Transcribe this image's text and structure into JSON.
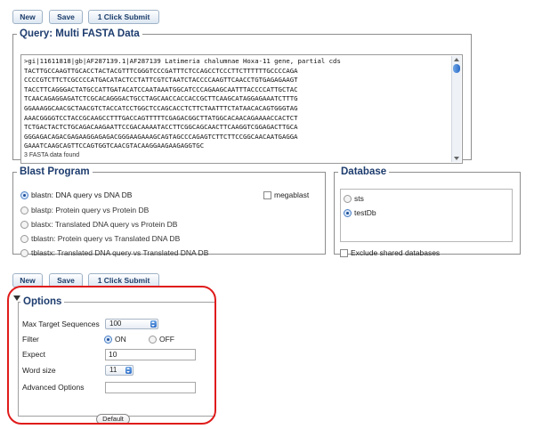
{
  "toolbar_top": {
    "new_label": "New",
    "save_label": "Save",
    "submit_label": "1 Click Submit"
  },
  "toolbar_bottom": {
    "new_label": "New",
    "save_label": "Save",
    "submit_label": "1 Click Submit"
  },
  "query": {
    "legend": "Query: Multi FASTA Data",
    "fasta_lines": [
      ">gi|11611818|gb|AF287139.1|AF287139 Latimeria chalumnae Hoxa-11 gene, partial cds",
      "TACTTGCCAAGTTGCACCTACTACGTTTCGGGTCCCGATTTCTCCAGCCTCCCTTCTTTTTTGCCCCAGA",
      "CCCCGTCTTCTCGCCCCATGACATACTCCTATTCGTCTAATCTACCCCAAGTTCAACCTGTGAGAGAAGT",
      "TACCTTCAGGGACTATGCCATTGATACATCCAATAAATGGCATCCCAGAAGCAATTTACCCCATTGCTAC",
      "TCAACAGAGGAGATCTCGCACAGGGACTGCCTAGCAACCACCACCGCTTCAAGCATAGGAGAAATCTTTG",
      "GGAAAGGCAACGCTAACGTCTACCATCCTGGCTCCAGCACCTCTTCTAATTTCTATAACACAGTGGGTAG",
      "AAACGGGGTCCTACCGCAAGCCTTTGACCAGTTTTTCGAGACGGCTTATGGCACAACAGAAAACCACTCT",
      "TCTGACTACTCTGCAGACAAGAATTCCGACAAAATACCTTCGGCAGCAACTTCAAGGTCGGAGACTTGCA",
      "GGGAGACAGACGAGAAGGAGAGACGGGAAGAAAGCAGTAGCCCAGAGTCTTCTTCCGGCAACAATGAGGA",
      "GAAATCAAGCAGTTCCAGTGGTCAACGTACAAGGAAGAAGAGGTGC"
    ],
    "count_text": "3 FASTA data found"
  },
  "blast_program": {
    "legend": "Blast Program",
    "options": [
      {
        "label": "blastn: DNA query vs DNA DB",
        "selected": true
      },
      {
        "label": "blastp: Protein query vs Protein DB",
        "selected": false
      },
      {
        "label": "blastx: Translated DNA query vs Protein DB",
        "selected": false
      },
      {
        "label": "tblastn: Protein query vs Translated DNA DB",
        "selected": false
      },
      {
        "label": "tblastx: Translated DNA query vs Translated DNA DB",
        "selected": false
      }
    ],
    "megablast_label": "megablast"
  },
  "database": {
    "legend": "Database",
    "items": [
      {
        "label": "sts",
        "selected": false
      },
      {
        "label": "testDb",
        "selected": true
      }
    ],
    "exclude_label": "Exclude shared databases"
  },
  "options": {
    "legend": "Options",
    "max_target_label": "Max Target Sequences",
    "max_target_value": "100",
    "filter_label": "Filter",
    "filter_on_label": "ON",
    "filter_off_label": "OFF",
    "filter_selected": "ON",
    "expect_label": "Expect",
    "expect_value": "10",
    "word_size_label": "Word size",
    "word_size_value": "11",
    "advanced_label": "Advanced Options",
    "advanced_value": "",
    "default_label": "Default"
  },
  "colors": {
    "legend_text": "#1d3c6e",
    "highlight_ring": "#e01b1b",
    "button_text": "#1d3e6b"
  }
}
